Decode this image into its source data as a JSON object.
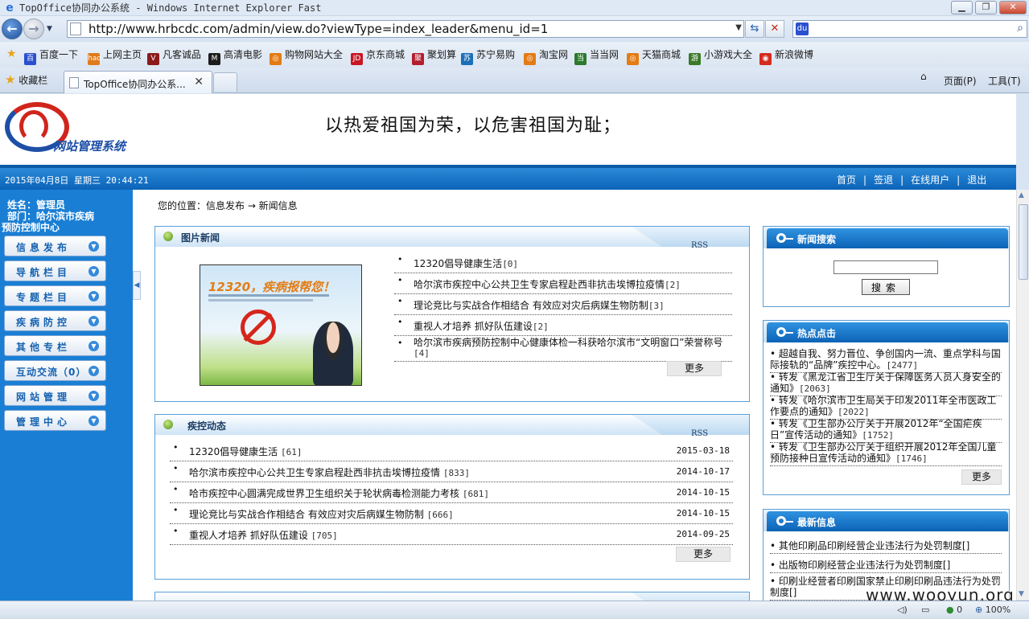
{
  "browser": {
    "window_title": "TopOffice协同办公系统 - Windows Internet Explorer Fast",
    "url": "http://www.hrbcdc.com/admin/view.do?viewType=index_leader&menu_id=1",
    "tab_title": "TopOffice协同办公系...",
    "favorites_label": "收藏栏",
    "page_menu": "页面(P)",
    "tools_menu": "工具(T)",
    "favorites": [
      {
        "label": "百度一下",
        "color": "#2a4fd0",
        "glyph": "百"
      },
      {
        "label": "上网主页",
        "color": "#e07b1a",
        "glyph": "hao"
      },
      {
        "label": "凡客诚品",
        "color": "#8b1a1a",
        "glyph": "V"
      },
      {
        "label": "高清电影",
        "color": "#1c1c1c",
        "glyph": "M"
      },
      {
        "label": "购物网站大全",
        "color": "#e37c14",
        "glyph": "◎"
      },
      {
        "label": "京东商城",
        "color": "#c81623",
        "glyph": "JD"
      },
      {
        "label": "聚划算",
        "color": "#b21e2e",
        "glyph": "聚"
      },
      {
        "label": "苏宁易购",
        "color": "#1b6fb8",
        "glyph": "苏"
      },
      {
        "label": "淘宝网",
        "color": "#e37c14",
        "glyph": "◎"
      },
      {
        "label": "当当网",
        "color": "#2d7a2d",
        "glyph": "当"
      },
      {
        "label": "天猫商城",
        "color": "#e37c14",
        "glyph": "◎"
      },
      {
        "label": "小游戏大全",
        "color": "#3a7a2a",
        "glyph": "游"
      },
      {
        "label": "新浪微博",
        "color": "#d52b1e",
        "glyph": "◉"
      }
    ],
    "status": {
      "security": "0",
      "zoom": "100%"
    }
  },
  "site": {
    "logo_text": "网站管理系统",
    "slogan": "以热爱祖国为荣，以危害祖国为耻；",
    "datetime": "2015年04月8日  星期三  20:44:21",
    "top_links": [
      "首页",
      "签退",
      "在线用户",
      "退出"
    ]
  },
  "user": {
    "name_line": "姓名：管理员",
    "dept_line1": "部门：哈尔滨市疾病",
    "dept_line2": "预防控制中心"
  },
  "menu": [
    {
      "label": "信息发布",
      "tight": false
    },
    {
      "label": "导航栏目",
      "tight": false
    },
    {
      "label": "专题栏目",
      "tight": false
    },
    {
      "label": "疾病防控",
      "tight": false
    },
    {
      "label": "其他专栏",
      "tight": false
    },
    {
      "label": "互动交流（0）",
      "tight": true
    },
    {
      "label": "网站管理",
      "tight": false
    },
    {
      "label": "管理中心",
      "tight": false
    }
  ],
  "breadcrumb": "您的位置：信息发布 → 新闻信息",
  "pic_news": {
    "title": "图片新闻",
    "rss": "RSS",
    "image_headline": "12320，疾病报帮您！",
    "items": [
      {
        "title": "12320倡导健康生活",
        "count": "[0]"
      },
      {
        "title": "哈尔滨市疾控中心公共卫生专家启程赴西非抗击埃博拉疫情",
        "count": "[2]"
      },
      {
        "title": "理论竞比与实战合作相结合 有效应对灾后病媒生物防制",
        "count": "[3]"
      },
      {
        "title": "重视人才培养 抓好队伍建设",
        "count": "[2]"
      },
      {
        "title": "哈尔滨市疾病预防控制中心健康体检一科获哈尔滨市“文明窗口”荣誉称号",
        "count": "[4]"
      }
    ],
    "more": "更多"
  },
  "control_news": {
    "title": "疾控动态",
    "rss": "RSS",
    "items": [
      {
        "title": "12320倡导健康生活",
        "count": "[61]",
        "date": "2015-03-18"
      },
      {
        "title": "哈尔滨市疾控中心公共卫生专家启程赴西非抗击埃博拉疫情",
        "count": "[833]",
        "date": "2014-10-17"
      },
      {
        "title": "哈市疾控中心圆满完成世界卫生组织关于轮状病毒检测能力考核",
        "count": "[681]",
        "date": "2014-10-15"
      },
      {
        "title": "理论竞比与实战合作相结合 有效应对灾后病媒生物防制",
        "count": "[666]",
        "date": "2014-10-15"
      },
      {
        "title": "重视人才培养 抓好队伍建设",
        "count": "[705]",
        "date": "2014-09-25"
      }
    ],
    "more": "更多"
  },
  "news_search": {
    "title": "新闻搜索",
    "input_value": "",
    "button": "搜索"
  },
  "hot": {
    "title": "热点点击",
    "items": [
      {
        "text": "超越自我、努力晋位、争创国内一流、重点学科与国际接轨的“品牌”疾控中心。",
        "count": "[2477]"
      },
      {
        "text": "转发《黑龙江省卫生厅关于保障医务人员人身安全的通知》",
        "count": "[2063]"
      },
      {
        "text": "转发《哈尔滨市卫生局关于印发2011年全市医政工作要点的通知》",
        "count": "[2022]"
      },
      {
        "text": "转发《卫生部办公厅关于开展2012年“全国疟疾日”宣传活动的通知》",
        "count": "[1752]"
      },
      {
        "text": "转发《卫生部办公厅关于组织开展2012年全国儿童预防接种日宣传活动的通知》",
        "count": "[1746]"
      }
    ],
    "more": "更多"
  },
  "latest": {
    "title": "最新信息",
    "items": [
      "其他印刷品印刷经营企业违法行为处罚制度[]",
      "出版物印刷经营企业违法行为处罚制度[]",
      "印刷业经营者印刷国家禁止印刷印刷品违法行为处罚制度[]"
    ]
  },
  "watermark": "www.wooyun.org"
}
